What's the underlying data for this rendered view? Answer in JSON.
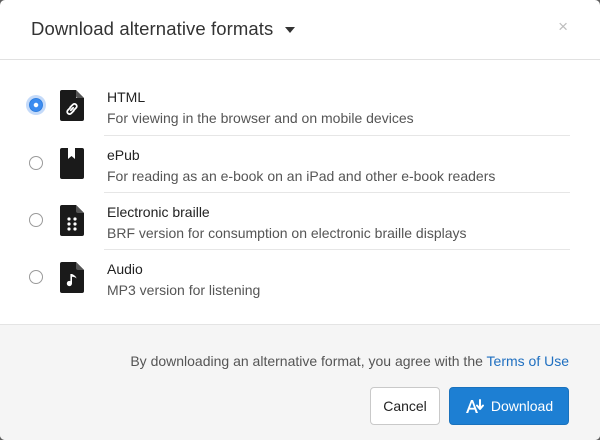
{
  "dialog": {
    "title": "Download alternative formats",
    "close_glyph": "×"
  },
  "options": [
    {
      "label": "HTML",
      "description": "For viewing in the browser and on mobile devices",
      "icon": "file-link-icon",
      "selected": true
    },
    {
      "label": "ePub",
      "description": "For reading as an e-book on an iPad and other e-book readers",
      "icon": "file-bookmark-icon",
      "selected": false
    },
    {
      "label": "Electronic braille",
      "description": "BRF version for consumption on electronic braille displays",
      "icon": "file-braille-icon",
      "selected": false
    },
    {
      "label": "Audio",
      "description": "MP3 version for listening",
      "icon": "file-music-icon",
      "selected": false
    }
  ],
  "footer": {
    "agree_text": "By downloading an alternative format, you agree with the ",
    "terms_link": "Terms of Use",
    "cancel_label": "Cancel",
    "download_label": "Download"
  },
  "colors": {
    "accent": "#1d7fd3",
    "link": "#1f6fc0",
    "radio_selected": "#3d8cf0"
  }
}
